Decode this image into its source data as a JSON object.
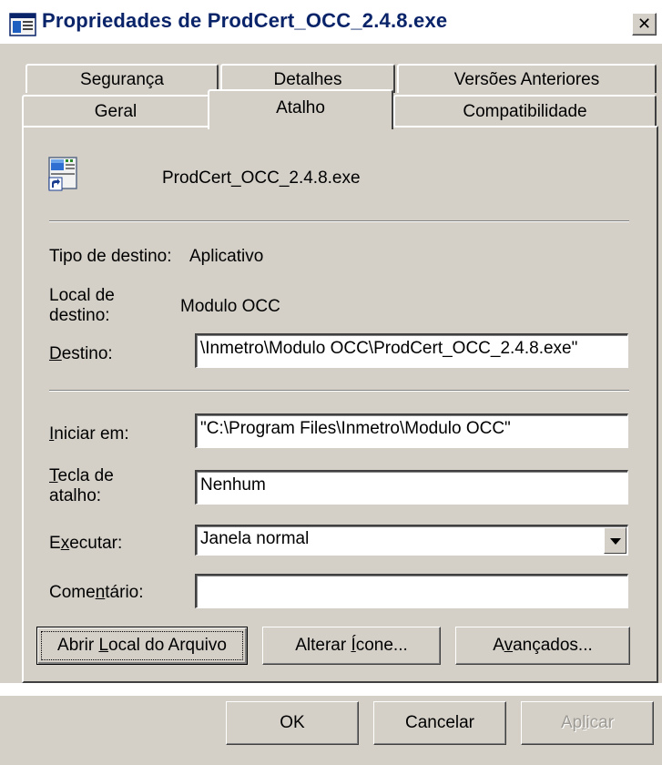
{
  "window": {
    "title": "Propriedades de ProdCert_OCC_2.4.8.exe",
    "close_glyph": "✕"
  },
  "tabs": {
    "row1": [
      "Segurança",
      "Detalhes",
      "Versões Anteriores"
    ],
    "row2": [
      "Geral",
      "Atalho",
      "Compatibilidade"
    ],
    "selected": "Atalho"
  },
  "shortcut": {
    "file_name": "ProdCert_OCC_2.4.8.exe",
    "target_type_label": "Tipo de destino:",
    "target_type_value": "Aplicativo",
    "target_location_label_1": "Local de",
    "target_location_label_2": "destino:",
    "target_location_value": "Modulo OCC",
    "target_label": "Destino:",
    "target_value": "\\Inmetro\\Modulo OCC\\ProdCert_OCC_2.4.8.exe\"",
    "start_in_label": "Iniciar em:",
    "start_in_value": "\"C:\\Program Files\\Inmetro\\Modulo OCC\"",
    "hotkey_label_1": "Tecla de",
    "hotkey_label_2": "atalho:",
    "hotkey_value": "Nenhum",
    "run_label": "Executar:",
    "run_value": "Janela normal",
    "comment_label": "Comentário:",
    "comment_value": ""
  },
  "buttons": {
    "open_location": "Abrir Local do Arquivo",
    "change_icon": "Alterar Ícone...",
    "advanced": "Avançados...",
    "ok": "OK",
    "cancel": "Cancelar",
    "apply": "Aplicar"
  },
  "icons": {
    "app": "window-properties-icon",
    "file": "shortcut-file-icon"
  }
}
